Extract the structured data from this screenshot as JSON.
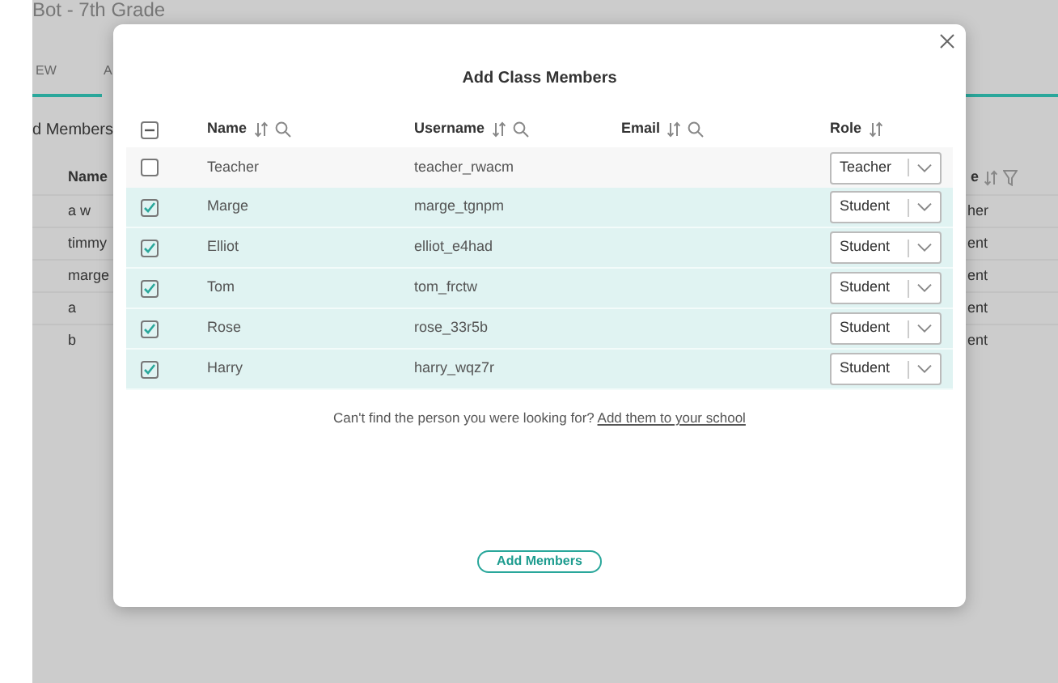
{
  "page": {
    "title": "Bot - 7th Grade",
    "tabs": [
      {
        "label": "EW",
        "selected": true
      },
      {
        "label": "A",
        "selected": false
      }
    ],
    "section_title": "d Members",
    "table": {
      "columns": [
        {
          "label": "Name",
          "sortable": false,
          "filterable": false
        },
        {
          "label": "e",
          "sortable": true,
          "filterable": true
        }
      ],
      "rows": [
        [
          "a w",
          "her"
        ],
        [
          "timmy",
          "ent"
        ],
        [
          "marge",
          "ent"
        ],
        [
          "a",
          "ent"
        ],
        [
          "b",
          "ent"
        ]
      ]
    }
  },
  "dialog": {
    "title": "Add Class Members",
    "select_all": {
      "checked": false,
      "indeterminate": true
    },
    "columns": [
      {
        "label": "Name",
        "sortable": true,
        "searchable": true
      },
      {
        "label": "Username",
        "sortable": true,
        "searchable": true
      },
      {
        "label": "Email",
        "sortable": true,
        "searchable": true
      },
      {
        "label": "Role",
        "sortable": true,
        "searchable": false
      }
    ],
    "rows": [
      {
        "name": "Teacher",
        "username": "teacher_rwacm",
        "role": "Teacher",
        "selected": false
      },
      {
        "name": "Marge",
        "username": "marge_tgnpm",
        "role": "Student",
        "selected": true
      },
      {
        "name": "Elliot",
        "username": "elliot_e4had",
        "role": "Student",
        "selected": true
      },
      {
        "name": "Tom",
        "username": "tom_frctw",
        "role": "Student",
        "selected": true
      },
      {
        "name": "Rose",
        "username": "rose_33r5b",
        "role": "Student",
        "selected": true
      },
      {
        "name": "Harry",
        "username": "harry_wqz7r",
        "role": "Student",
        "selected": true
      }
    ],
    "hint": "Can't find the person you were looking for?",
    "hint_link": "Add them to your school",
    "submit": "Add Members"
  }
}
